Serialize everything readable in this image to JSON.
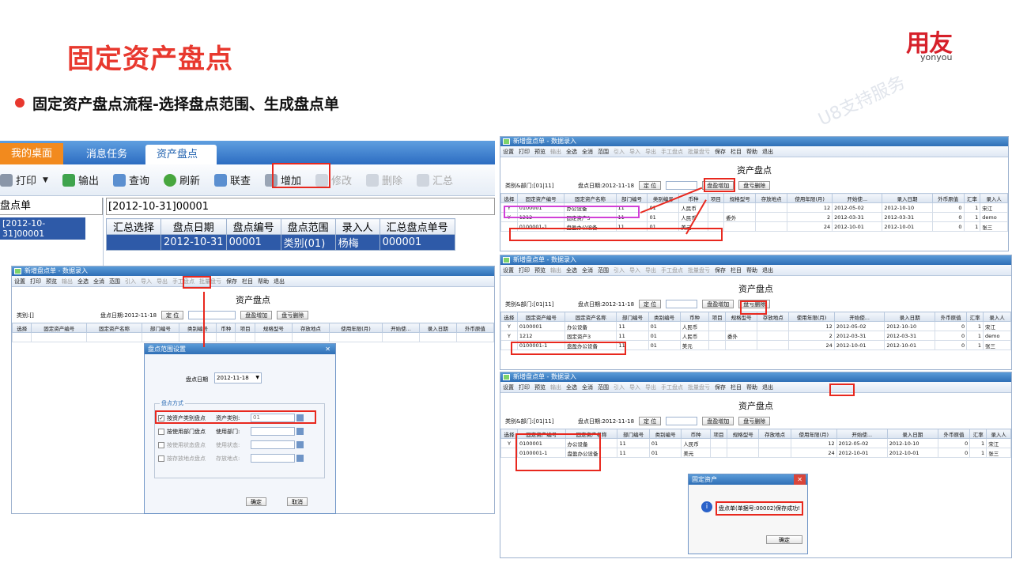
{
  "slide": {
    "title": "固定资产盘点",
    "bullet": "固定资产盘点流程-选择盘点范围、生成盘点单",
    "watermark": "U8支持服务",
    "logo": {
      "cn": "用友",
      "en": "yonyou"
    },
    "colors": {
      "accent": "#e8382e",
      "blue": "#2e5aa8"
    }
  },
  "app": {
    "tabs": [
      "我的桌面",
      "消息任务",
      "资产盘点"
    ],
    "toolbar": [
      "打印",
      "输出",
      "查询",
      "刷新",
      "联查",
      "增加",
      "修改",
      "删除",
      "汇总"
    ],
    "left_header": "盘点单",
    "left_item": "[2012-10-31]00001",
    "right_header": "[2012-10-31]00001",
    "columns": [
      "汇总选择",
      "盘点日期",
      "盘点编号",
      "盘点范围",
      "录入人",
      "汇总盘点单号"
    ],
    "row": [
      "",
      "2012-10-31",
      "00001",
      "类别(01)",
      "杨梅",
      "000001"
    ]
  },
  "entry": {
    "win_title": "新增盘点单 - 数据录入",
    "toolbar": [
      "设置",
      "打印",
      "预览",
      "输出",
      "全选",
      "全消",
      "范围",
      "引入",
      "导入",
      "导出",
      "手工盘点",
      "批量盘亏",
      "保存",
      "栏目",
      "帮助",
      "退出"
    ],
    "heading": "资产盘点",
    "locate": "定 位",
    "btn_add": "盘盈增加",
    "btn_del": "盘亏删除",
    "date_label": "盘点日期:2012-11-18",
    "columns": [
      "选择",
      "固定资产编号",
      "固定资产名称",
      "部门编号",
      "类别编号",
      "币种",
      "项目",
      "规格型号",
      "存放地点",
      "使用年限(月)",
      "开始使...",
      "录入日期",
      "外币原值",
      "汇率",
      "录入人"
    ]
  },
  "left_entry": {
    "category": "类别:[]",
    "columns": [
      "选择",
      "固定资产编号",
      "固定资产名称",
      "部门编号",
      "类别编号",
      "币种",
      "项目",
      "规格型号",
      "存放地点",
      "使用年限(月)",
      "开始使...",
      "录入日期",
      "外币原值"
    ]
  },
  "range_dialog": {
    "title": "盘点范围设置",
    "date_label": "盘点日期",
    "date_value": "2012-11-18",
    "group": "盘点方式",
    "options": [
      {
        "label": "按资产类别盘点",
        "field": "资产类别:",
        "value": "01",
        "checked": true
      },
      {
        "label": "按使用部门盘点",
        "field": "使用部门:",
        "value": "",
        "checked": false
      },
      {
        "label": "按使用状态盘点",
        "field": "使用状态:",
        "value": "",
        "checked": false
      },
      {
        "label": "按存放地点盘点",
        "field": "存放地点:",
        "value": "",
        "checked": false
      }
    ],
    "ok": "确定",
    "cancel": "取消"
  },
  "panel1": {
    "category": "类别&部门:[01|11]",
    "rows": [
      [
        "Y",
        "0100001",
        "办公设备",
        "11",
        "01",
        "人民币",
        "",
        "",
        "",
        "12",
        "2012-05-02",
        "2012-10-10",
        "0",
        "1",
        "宋江"
      ],
      [
        "Y",
        "1212",
        "固定资产3",
        "11",
        "01",
        "人民币",
        "",
        "委外",
        "",
        "2",
        "2012-03-31",
        "2012-03-31",
        "0",
        "1",
        "demo"
      ],
      [
        "",
        "0100001-1",
        "盘盈办公设备",
        "11",
        "01",
        "美元",
        "",
        "",
        "",
        "24",
        "2012-10-01",
        "2012-10-01",
        "0",
        "1",
        "张三"
      ]
    ]
  },
  "panel2": {
    "category": "类别&部门:[01|11]",
    "rows": [
      [
        "Y",
        "0100001",
        "办公设备",
        "11",
        "01",
        "人民币",
        "",
        "",
        "",
        "12",
        "2012-05-02",
        "2012-10-10",
        "0",
        "1",
        "宋江"
      ],
      [
        "Y",
        "1212",
        "固定资产3",
        "11",
        "01",
        "人民币",
        "",
        "委外",
        "",
        "2",
        "2012-03-31",
        "2012-03-31",
        "0",
        "1",
        "demo"
      ],
      [
        "",
        "0100001-1",
        "盘盈办公设备",
        "11",
        "01",
        "美元",
        "",
        "",
        "",
        "24",
        "2012-10-01",
        "2012-10-01",
        "0",
        "1",
        "张三"
      ]
    ]
  },
  "panel3": {
    "category": "类别&部门:[01|11]",
    "rows": [
      [
        "Y",
        "0100001",
        "办公设备",
        "11",
        "01",
        "人民币",
        "",
        "",
        "",
        "12",
        "2012-05-02",
        "2012-10-10",
        "0",
        "1",
        "宋江"
      ],
      [
        "",
        "0100001-1",
        "盘盈办公设备",
        "11",
        "01",
        "美元",
        "",
        "",
        "",
        "24",
        "2012-10-01",
        "2012-10-01",
        "0",
        "1",
        "张三"
      ]
    ]
  },
  "msg": {
    "title": "固定资产",
    "text": "盘点单(单据号:00002)保存成功!",
    "ok": "确定"
  }
}
